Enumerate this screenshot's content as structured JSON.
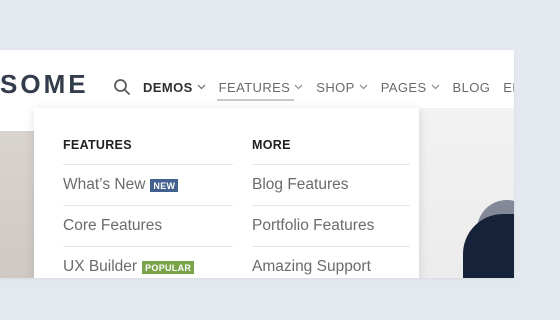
{
  "header": {
    "logo_text": "SOME",
    "search_icon": "search-icon"
  },
  "nav": {
    "items": [
      {
        "label": "DEMOS",
        "has_dropdown": true,
        "active": true
      },
      {
        "label": "FEATURES",
        "has_dropdown": true,
        "active": false,
        "open": true
      },
      {
        "label": "SHOP",
        "has_dropdown": true,
        "active": false
      },
      {
        "label": "PAGES",
        "has_dropdown": true,
        "active": false
      },
      {
        "label": "BLOG",
        "has_dropdown": false,
        "active": false
      },
      {
        "label": "ELEM",
        "has_dropdown": false,
        "active": false
      }
    ]
  },
  "dropdown": {
    "features": {
      "heading": "FEATURES",
      "items": [
        {
          "label": "What’s New",
          "badge": "NEW"
        },
        {
          "label": "Core Features",
          "badge": ""
        },
        {
          "label": "UX Builder",
          "badge": "POPULAR"
        }
      ]
    },
    "more": {
      "heading": "MORE",
      "items": [
        {
          "label": "Blog Features"
        },
        {
          "label": "Portfolio Features"
        },
        {
          "label": "Amazing Support"
        }
      ]
    }
  },
  "colors": {
    "background": "#e3e9ee",
    "badge_new": "#43618f",
    "badge_popular": "#7aa34a",
    "text_dark": "#1f1f1f",
    "text_muted": "#6b6b6b"
  }
}
